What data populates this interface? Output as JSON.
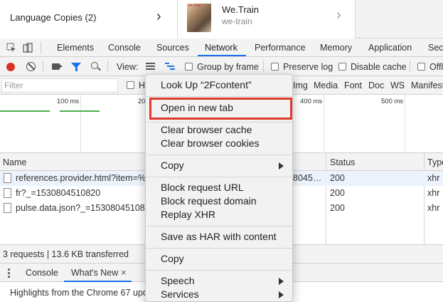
{
  "top_cards": {
    "language_copies": "Language Copies (2)",
    "app": {
      "name": "We.Train",
      "subtitle": "we-train",
      "thumb_text": "we.retail"
    }
  },
  "devtools_tabs": [
    "Elements",
    "Console",
    "Sources",
    "Network",
    "Performance",
    "Memory",
    "Application",
    "Sec"
  ],
  "active_tab": "Network",
  "network_toolbar": {
    "view_label": "View:",
    "group_by_frame": "Group by frame",
    "preserve_log": "Preserve log",
    "disable_cache": "Disable cache",
    "offline": "Offl"
  },
  "filter_bar": {
    "placeholder": "Filter",
    "hide_data_partial": "H",
    "types": [
      "Img",
      "Media",
      "Font",
      "Doc",
      "WS",
      "Manifest"
    ]
  },
  "timeline_ticks": [
    "100 ms",
    "20",
    "400 ms",
    "500 ms"
  ],
  "table": {
    "headers": {
      "name": "Name",
      "status": "Status",
      "type": "Type"
    },
    "rows": [
      {
        "name": "references.provider.html?item=%2",
        "extra": "8045…",
        "status": "200",
        "type": "xhr"
      },
      {
        "name": "fr?_=1530804510820",
        "extra": "",
        "status": "200",
        "type": "xhr"
      },
      {
        "name": "pulse.data.json?_=15308045108",
        "extra": "",
        "status": "200",
        "type": "xhr"
      }
    ]
  },
  "status_bar": "3 requests | 13.6 KB transferred",
  "drawer": {
    "tabs": [
      "Console",
      "What's New"
    ],
    "close": "×",
    "content": "Highlights from the Chrome 67 upda"
  },
  "context_menu": {
    "look_up": "Look Up “2Fcontent”",
    "open_new_tab": "Open in new tab",
    "clear_cache": "Clear browser cache",
    "clear_cookies": "Clear browser cookies",
    "copy_sub": "Copy",
    "block_url": "Block request URL",
    "block_domain": "Block request domain",
    "replay_xhr": "Replay XHR",
    "save_har": "Save as HAR with content",
    "copy": "Copy",
    "speech": "Speech",
    "services": "Services"
  },
  "colors": {
    "accent": "#1a73e8",
    "record": "#d93025",
    "highlight_box": "#e03a2f"
  }
}
